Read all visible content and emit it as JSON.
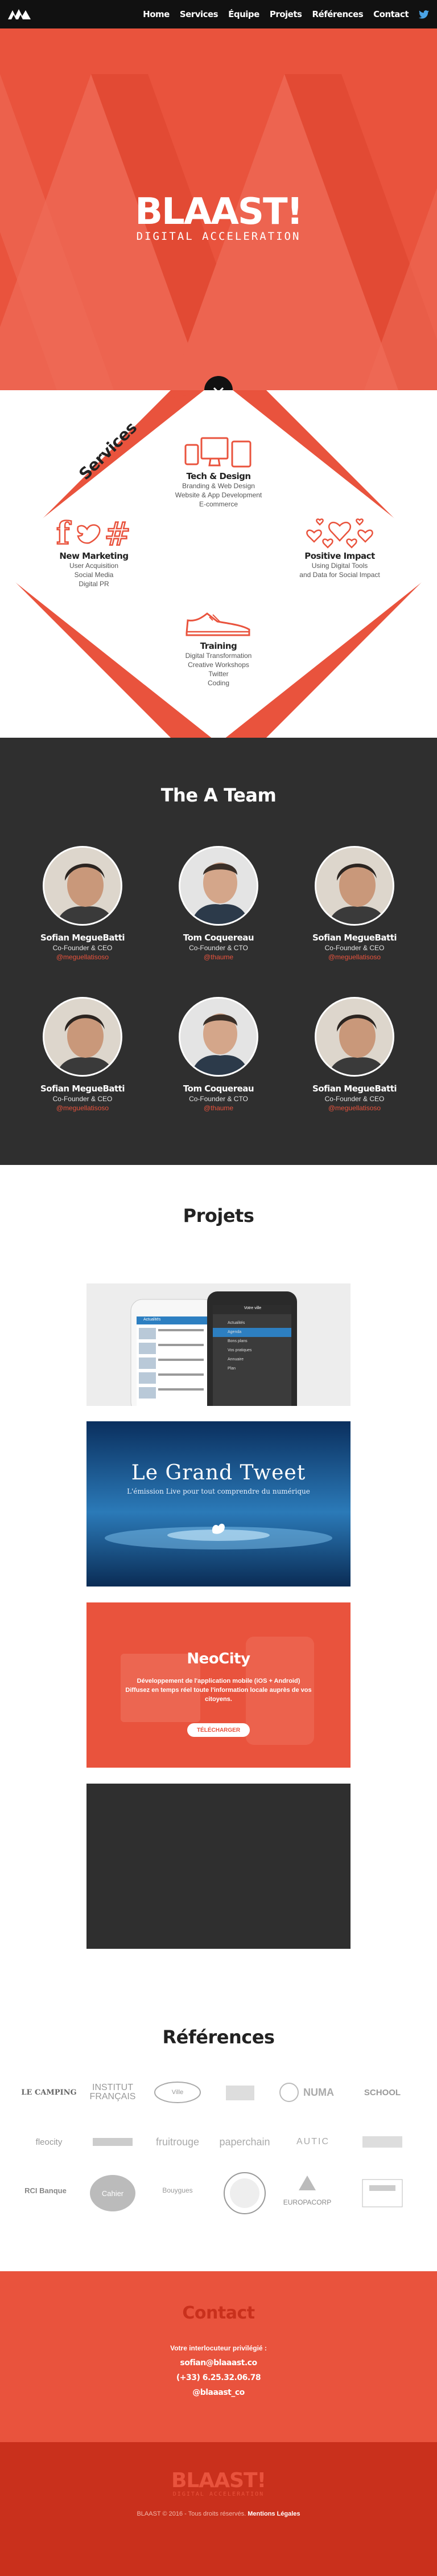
{
  "nav": {
    "items": [
      "Home",
      "Services",
      "Équipe",
      "Projets",
      "Références",
      "Contact"
    ]
  },
  "hero": {
    "brand": "BLAAST!",
    "tagline": "DIGITAL ACCELERATION",
    "accent": "#e9533d"
  },
  "services": {
    "title": "Services",
    "items": [
      {
        "icon": "devices-icon",
        "title": "Tech & Design",
        "lines": [
          "Branding & Web Design",
          "Website & App Development",
          "E-commerce"
        ]
      },
      {
        "icon": "social-icon",
        "title": "New Marketing",
        "lines": [
          "User Acquisition",
          "Social Media",
          "Digital PR"
        ]
      },
      {
        "icon": "hearts-icon",
        "title": "Positive Impact",
        "lines": [
          "Using Digital Tools",
          "and Data for Social Impact"
        ]
      },
      {
        "icon": "sneaker-icon",
        "title": "Training",
        "lines": [
          "Digital Transformation",
          "Creative Workshops",
          "Twitter",
          "Coding"
        ]
      }
    ]
  },
  "team": {
    "title": "The A Team",
    "members": [
      {
        "name": "Sofian MegueBatti",
        "role": "Co-Founder & CEO",
        "handle": "@meguellatisoso"
      },
      {
        "name": "Tom Coquereau",
        "role": "Co-Founder & CTO",
        "handle": "@thaume"
      },
      {
        "name": "Sofian MegueBatti",
        "role": "Co-Founder & CEO",
        "handle": "@meguellatisoso"
      },
      {
        "name": "Sofian MegueBatti",
        "role": "Co-Founder & CEO",
        "handle": "@meguellatisoso"
      },
      {
        "name": "Tom Coquereau",
        "role": "Co-Founder & CTO",
        "handle": "@thaume"
      },
      {
        "name": "Sofian MegueBatti",
        "role": "Co-Founder & CEO",
        "handle": "@meguellatisoso"
      }
    ]
  },
  "projets": {
    "title": "Projets",
    "phones": {
      "left_header": "Actualités",
      "right_header": "Votre ville",
      "menu": [
        "Actualités",
        "Agenda",
        "Bons plans",
        "Vos pratiques",
        "Annuaire",
        "Plan"
      ]
    },
    "tweet": {
      "title": "Le Grand Tweet",
      "subtitle": "L'émission Live pour tout comprendre du numérique"
    },
    "neocity": {
      "name": "NeoCity",
      "text1": "Développement de l'application mobile (iOS + Android)",
      "text2": "Diffusez en temps réel toute l'information locale auprès de vos citoyens.",
      "button": "TÉLÉCHARGER"
    }
  },
  "references": {
    "title": "Références",
    "logos": [
      "LE CAMPING",
      "INSTITUT FRANÇAIS",
      "Ville",
      "",
      "",
      "NUMA",
      "SCHOOL",
      "fleocity",
      "",
      "fruitrouge",
      "paperchain",
      "AUTIC",
      "",
      "RCI Banque",
      "Cahier",
      "Bouygues",
      "",
      "",
      "EUROPACORP",
      ""
    ]
  },
  "contact": {
    "title": "Contact",
    "lead": "Votre interlocuteur privilégié :",
    "email": "sofian@blaaast.co",
    "phone": "(+33) 6.25.32.06.78",
    "twitter": "@blaaast_co"
  },
  "footer": {
    "brand": "BLAAST!",
    "tagline": "DIGITAL ACCELERATION",
    "copyright": "BLAAST © 2016 - Tous droits réservés.",
    "legal": "Mentions Légales"
  }
}
